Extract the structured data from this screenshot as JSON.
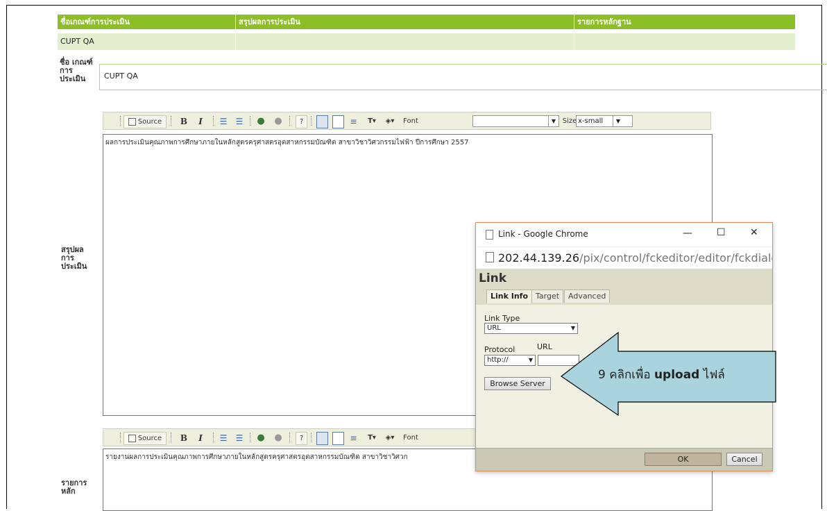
{
  "table": {
    "headers": [
      "ชื่อเกณฑ์การประเมิน",
      "สรุปผลการประเมิน",
      "รายการหลักฐาน"
    ],
    "row": [
      "CUPT QA",
      "",
      ""
    ]
  },
  "form": {
    "name_label": "ชื่อ เกณฑ์ การ ประเมิน",
    "name_value": "CUPT QA",
    "summary_label": "สรุปผล การ ประเมิน",
    "summary_text": "ผลการประเมินคุณภาพการศึกษาภายในหลักสูตรครุศาสตรอุตสาหกรรมบัณฑิต สาขาวิชาวิศวกรรมไฟฟ้า ปีการศึกษา 2557",
    "evidence_label": "รายการ หลัก",
    "evidence_text": "รายงานผลการประเมินคุณภาพการศึกษาภายในหลักสูตรครุศาสตรอุตสาหกรรมบัณฑิต สาขาวิชาวิศวก"
  },
  "toolbar": {
    "source_label": "Source",
    "bold_label": "B",
    "italic_label": "I",
    "font_label": "Font",
    "font_value": "",
    "size_label": "Size",
    "size_value": "x-small"
  },
  "dialog": {
    "window_title": "Link - Google Chrome",
    "minimize": "—",
    "maximize": "☐",
    "close": "✕",
    "url_host": "202.44.139.26",
    "url_path": "/pix/control/fckeditor/editor/fckdialc",
    "heading": "Link",
    "tabs": [
      "Link Info",
      "Target",
      "Advanced"
    ],
    "link_type_label": "Link Type",
    "link_type_value": "URL",
    "protocol_label": "Protocol",
    "protocol_value": "http://",
    "url_label": "URL",
    "url_value": "",
    "browse_button": "Browse Server",
    "ok_button": "OK",
    "cancel_button": "Cancel"
  },
  "callout": {
    "text_prefix": "9 คลิกเพื่อ ",
    "text_bold": "upload",
    "text_suffix": " ไฟล์",
    "fill": "#a9d4dd"
  },
  "colors": {
    "header_green": "#8cbf26",
    "row_green": "#e4efcf",
    "dialog_border": "#e28a55"
  }
}
